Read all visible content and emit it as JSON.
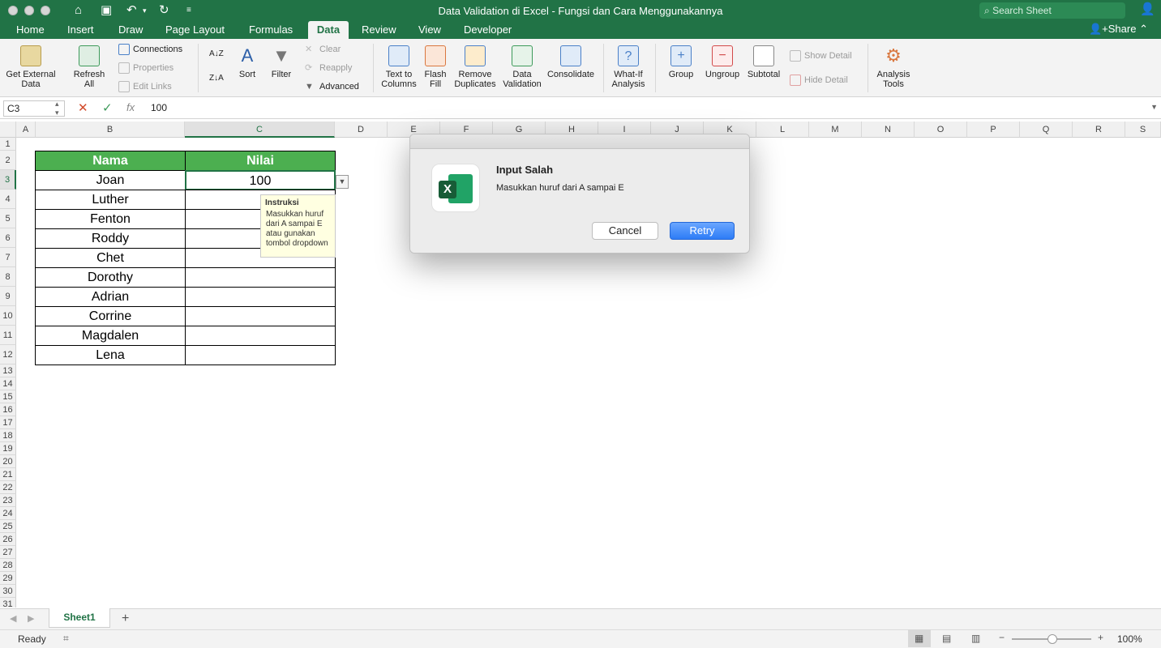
{
  "window": {
    "title": "Data Validation di Excel - Fungsi dan Cara Menggunakannya",
    "search_placeholder": "Search Sheet",
    "share_label": "Share"
  },
  "menu_tabs": [
    "Home",
    "Insert",
    "Draw",
    "Page Layout",
    "Formulas",
    "Data",
    "Review",
    "View",
    "Developer"
  ],
  "active_tab": "Data",
  "ribbon": {
    "get_external_data": "Get External\nData",
    "refresh_all": "Refresh\nAll",
    "connections": "Connections",
    "properties": "Properties",
    "edit_links": "Edit Links",
    "sort": "Sort",
    "filter": "Filter",
    "clear": "Clear",
    "reapply": "Reapply",
    "advanced": "Advanced",
    "text_to_columns": "Text to\nColumns",
    "flash_fill": "Flash\nFill",
    "remove_duplicates": "Remove\nDuplicates",
    "data_validation": "Data\nValidation",
    "consolidate": "Consolidate",
    "what_if_analysis": "What-If\nAnalysis",
    "group": "Group",
    "ungroup": "Ungroup",
    "subtotal": "Subtotal",
    "show_detail": "Show Detail",
    "hide_detail": "Hide Detail",
    "analysis_tools": "Analysis\nTools"
  },
  "formula_bar": {
    "name_box": "C3",
    "fx": "fx",
    "value": "100"
  },
  "columns": [
    "A",
    "B",
    "C",
    "D",
    "E",
    "F",
    "G",
    "H",
    "I",
    "J",
    "K",
    "L",
    "M",
    "N",
    "O",
    "P",
    "Q",
    "R",
    "S"
  ],
  "rows": [
    "1",
    "2",
    "3",
    "4",
    "5",
    "6",
    "7",
    "8",
    "9",
    "10",
    "11",
    "12",
    "13",
    "14",
    "15",
    "16",
    "17",
    "18",
    "19",
    "20",
    "21",
    "22",
    "23",
    "24",
    "25",
    "26",
    "27",
    "28",
    "29",
    "30",
    "31"
  ],
  "table": {
    "headers": [
      "Nama",
      "Nilai"
    ],
    "names": [
      "Joan",
      "Luther",
      "Fenton",
      "Roddy",
      "Chet",
      "Dorothy",
      "Adrian",
      "Corrine",
      "Magdalen",
      "Lena"
    ],
    "nilai": [
      "100",
      "",
      "",
      "",
      "",
      "",
      "",
      "",
      "",
      ""
    ]
  },
  "tooltip": {
    "title": "Instruksi",
    "body": "Masukkan huruf dari A sampai E atau gunakan tombol dropdown"
  },
  "dialog": {
    "title": "Input Salah",
    "message": "Masukkan huruf dari A sampai E",
    "cancel": "Cancel",
    "retry": "Retry",
    "icon_letter": "X"
  },
  "sheet": {
    "tab": "Sheet1",
    "add": "+"
  },
  "status": {
    "text": "Ready",
    "zoom": "100%"
  },
  "colors": {
    "excel_green": "#217346",
    "header_green": "#4caf50",
    "retry_blue": "#3b82f6"
  }
}
